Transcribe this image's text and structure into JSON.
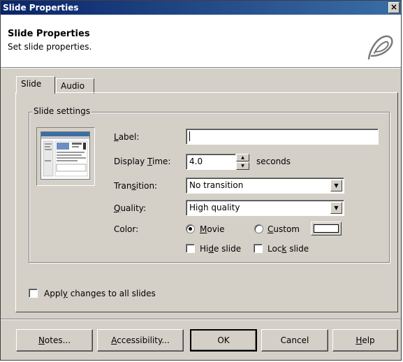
{
  "window": {
    "title": "Slide Properties",
    "close_glyph": "×"
  },
  "header": {
    "title": "Slide Properties",
    "subtitle": "Set slide properties.",
    "logo_icon": "captivate-logo-icon"
  },
  "tabs": [
    {
      "label": "Slide",
      "active": true
    },
    {
      "label": "Audio",
      "active": false
    }
  ],
  "slide_settings": {
    "legend": "Slide settings",
    "label": {
      "pre": "",
      "key": "L",
      "post": "abel:",
      "value": ""
    },
    "display_time": {
      "pre": "Display ",
      "key": "T",
      "post": "ime:",
      "value": "4.0",
      "unit": "seconds"
    },
    "transition": {
      "pre": "Tran",
      "key": "s",
      "post": "ition:",
      "selected": "No transition"
    },
    "quality": {
      "pre": "",
      "key": "Q",
      "post": "uality:",
      "selected": "High quality"
    },
    "color": {
      "label": "Color:",
      "movie": {
        "pre": "",
        "key": "M",
        "post": "ovie",
        "selected": true
      },
      "custom": {
        "pre": "",
        "key": "C",
        "post": "ustom",
        "selected": false
      },
      "swatch_color": "#ffffff"
    },
    "hide_slide": {
      "pre": "Hi",
      "key": "d",
      "post": "e slide",
      "checked": false
    },
    "lock_slide": {
      "pre": "Loc",
      "key": "k",
      "post": " slide",
      "checked": false
    }
  },
  "apply_all": {
    "pre": "Appl",
    "key": "y",
    "post": " changes to all slides",
    "checked": false
  },
  "buttons": {
    "notes": {
      "pre": "",
      "key": "N",
      "post": "otes..."
    },
    "accessibility": {
      "pre": "",
      "key": "A",
      "post": "ccessibility..."
    },
    "ok": "OK",
    "cancel": "Cancel",
    "help": {
      "pre": "",
      "key": "H",
      "post": "elp"
    }
  },
  "colors": {
    "titlebar": "#0a246a",
    "face": "#d4d0c8"
  }
}
